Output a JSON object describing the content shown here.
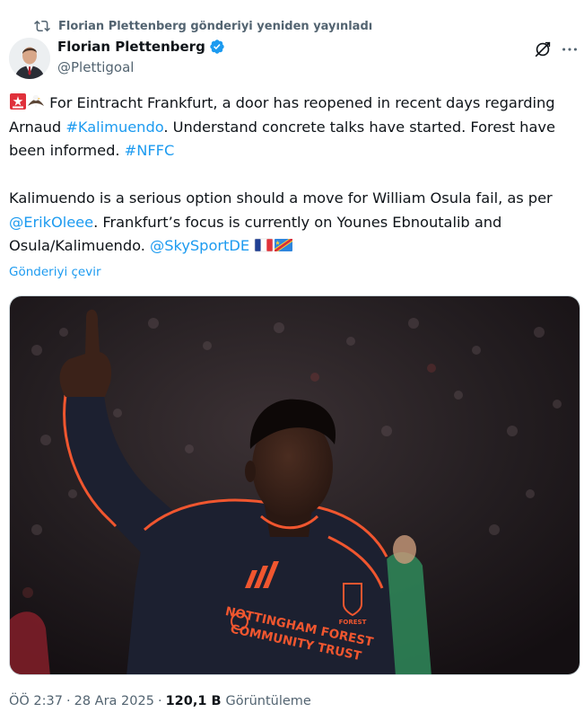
{
  "repost": {
    "text": "Florian Plettenberg gönderiyi yeniden yayınladı",
    "icon": "repost-icon"
  },
  "author": {
    "name": "Florian Plettenberg",
    "handle": "@Plettigoal",
    "verified": true,
    "verified_color": "#1d9bf0"
  },
  "header_icons": [
    "grok-icon",
    "more-icon"
  ],
  "tweet": {
    "p1_emojis": [
      "siren-emoji",
      "eagle-emoji"
    ],
    "p1_a": " For Eintracht Frankfurt, a door has reopened in recent days regarding Arnaud ",
    "p1_link": "#Kalimuendo",
    "p1_b": ". Understand concrete talks have started. Forest have been informed. ",
    "p1_tag": "#NFFC",
    "p2_a": "Kalimuendo is a serious option should a move for William Osula fail, as per ",
    "p2_link": "@ErikOleee",
    "p2_b": ". Frankfurt’s focus is currently on Younes Ebnoutalib and Osula/Kalimuendo. ",
    "p2_mention": "@SkySportDE",
    "p2_flags": [
      "france-flag-emoji",
      "dr-congo-flag-emoji"
    ]
  },
  "translate_label": "Gönderiyi çevir",
  "media": {
    "alt": "Player celebrating with raised finger",
    "shirt_text_1": "NOTTINGHAM FOREST",
    "shirt_text_2": "COMMUNITY TRUST",
    "crest_text": "FOREST",
    "shirt_color": "#1c2030",
    "trim_color": "#f0562f"
  },
  "meta": {
    "time": "ÖÖ 2:37",
    "date": "28 Ara 2025",
    "views": "120,1 B",
    "views_label": "Görüntüleme",
    "separator": "·"
  },
  "colors": {
    "link": "#1d9bf0",
    "secondary": "#536471",
    "primary": "#0f1419"
  }
}
